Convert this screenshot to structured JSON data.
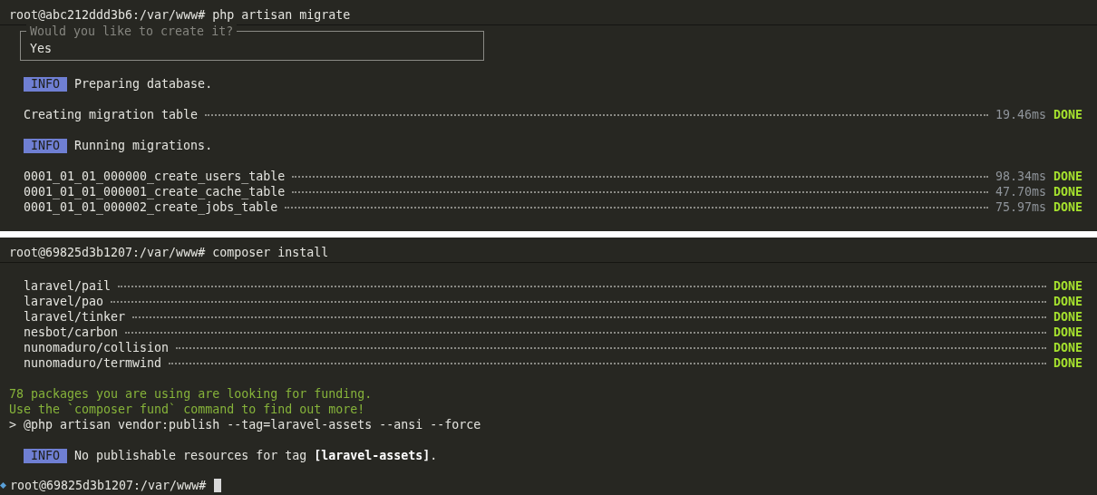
{
  "panels": [
    {
      "prompt": "root@abc212ddd3b6:/var/www#",
      "command": "php artisan migrate",
      "blocks": [
        {
          "kind": "question",
          "label": "Would you like to create it?",
          "value": "Yes"
        },
        {
          "kind": "info",
          "badge": "INFO",
          "text": "Preparing database."
        },
        {
          "kind": "tasks",
          "rows": [
            {
              "name": "Creating migration table",
              "time": "19.46ms",
              "status": "DONE"
            }
          ]
        },
        {
          "kind": "info",
          "badge": "INFO",
          "text": "Running migrations."
        },
        {
          "kind": "tasks",
          "rows": [
            {
              "name": "0001_01_01_000000_create_users_table",
              "time": "98.34ms",
              "status": "DONE"
            },
            {
              "name": "0001_01_01_000001_create_cache_table",
              "time": "47.70ms",
              "status": "DONE"
            },
            {
              "name": "0001_01_01_000002_create_jobs_table",
              "time": "75.97ms",
              "status": "DONE"
            }
          ]
        }
      ]
    },
    {
      "prompt": "root@69825d3b1207:/var/www#",
      "command": "composer install",
      "blocks": [
        {
          "kind": "tasks",
          "rows": [
            {
              "name": "laravel/pail",
              "status": "DONE"
            },
            {
              "name": "laravel/pao",
              "status": "DONE"
            },
            {
              "name": "laravel/tinker",
              "status": "DONE"
            },
            {
              "name": "nesbot/carbon",
              "status": "DONE"
            },
            {
              "name": "nunomaduro/collision",
              "status": "DONE"
            },
            {
              "name": "nunomaduro/termwind",
              "status": "DONE"
            }
          ]
        },
        {
          "kind": "notice",
          "lines": [
            "78 packages you are using are looking for funding.",
            "Use the `composer fund` command to find out more!"
          ]
        },
        {
          "kind": "output",
          "text": "> @php artisan vendor:publish --tag=laravel-assets --ansi --force"
        },
        {
          "kind": "info",
          "badge": "INFO",
          "text": "No publishable resources for tag **[laravel-assets]**."
        }
      ],
      "final_prompt": "root@69825d3b1207:/var/www#"
    }
  ]
}
